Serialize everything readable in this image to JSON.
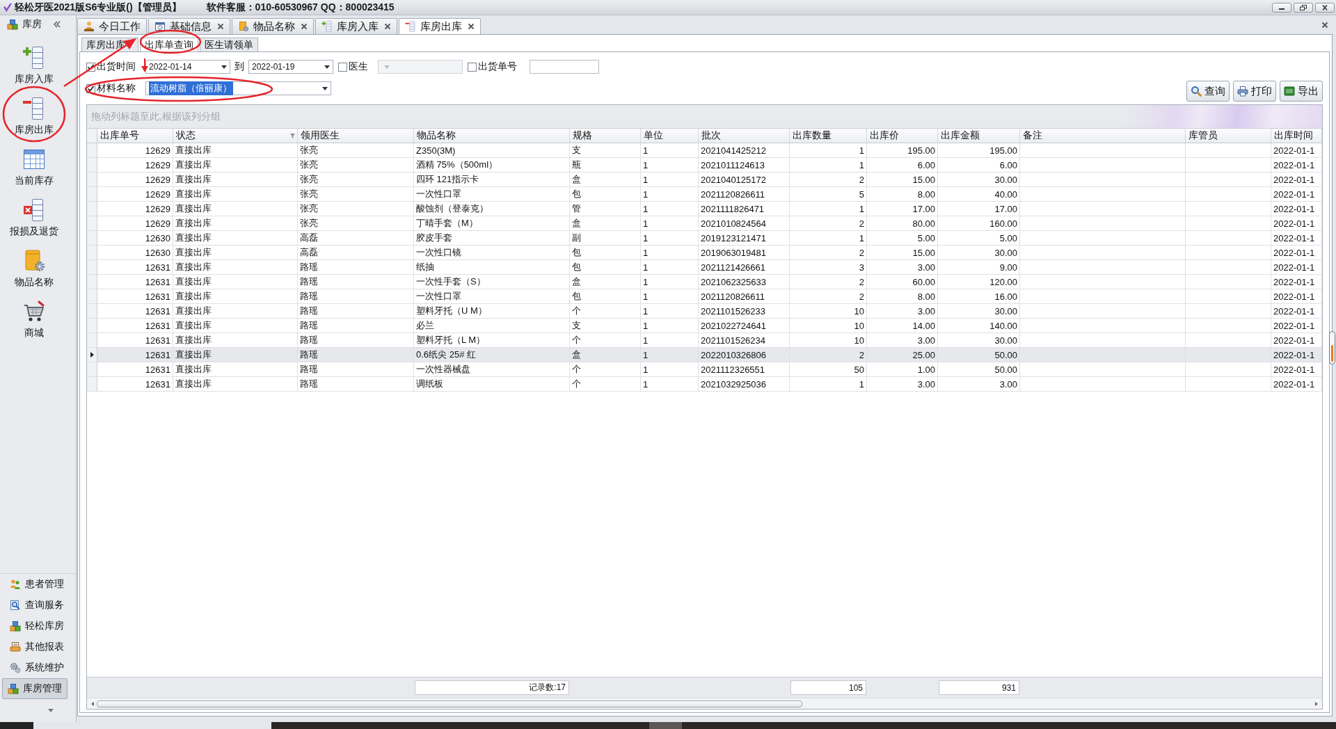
{
  "window": {
    "title": "轻松牙医2021版S6专业版()【管理员】",
    "support": "软件客服：010-60530967 QQ：800023415"
  },
  "sidebar": {
    "header": "库房",
    "items": [
      {
        "label": "库房入库",
        "kind": "stock_in"
      },
      {
        "label": "库房出库",
        "kind": "stock_out"
      },
      {
        "label": "当前库存",
        "kind": "inventory"
      },
      {
        "label": "报损及退货",
        "kind": "loss"
      },
      {
        "label": "物品名称",
        "kind": "goods"
      },
      {
        "label": "商城",
        "kind": "shop"
      }
    ],
    "nav": [
      {
        "label": "患者管理",
        "kind": "patients",
        "selected": false
      },
      {
        "label": "查询服务",
        "kind": "query",
        "selected": false
      },
      {
        "label": "轻松库房",
        "kind": "store",
        "selected": false
      },
      {
        "label": "其他报表",
        "kind": "report",
        "selected": false
      },
      {
        "label": "系统维护",
        "kind": "system",
        "selected": false
      },
      {
        "label": "库房管理",
        "kind": "store",
        "selected": true
      }
    ]
  },
  "tabs": [
    {
      "label": "今日工作",
      "kind": "today",
      "closable": false,
      "selected": false
    },
    {
      "label": "基础信息",
      "kind": "basic",
      "closable": true,
      "selected": false
    },
    {
      "label": "物品名称",
      "kind": "goods",
      "closable": true,
      "selected": false
    },
    {
      "label": "库房入库",
      "kind": "stock_in",
      "closable": true,
      "selected": false
    },
    {
      "label": "库房出库",
      "kind": "stock_out",
      "closable": true,
      "selected": true
    }
  ],
  "subtabs": [
    {
      "label": "库房出库",
      "selected": false
    },
    {
      "label": "出库单查询",
      "selected": true
    },
    {
      "label": "医生请领单",
      "selected": false
    }
  ],
  "filters": [
    [
      {
        "kind": "date_range",
        "label": "出货时间",
        "checked": true,
        "from": "2022-01-14",
        "separator": "到",
        "to": "2022-01-19"
      },
      {
        "kind": "combo",
        "label": "医生",
        "checked": false,
        "disabled": true
      },
      {
        "kind": "text",
        "label": "出货单号",
        "checked": false
      }
    ],
    [
      {
        "kind": "combo",
        "label": "材料名称",
        "checked": true,
        "disabled": false,
        "value": "流动树脂（倍丽康）",
        "text_selected": true
      }
    ]
  ],
  "buttons": [
    {
      "label": "查询",
      "kind": "search"
    },
    {
      "label": "打印",
      "kind": "print"
    },
    {
      "label": "导出",
      "kind": "export"
    }
  ],
  "grid": {
    "group_hint": "拖动列标题至此,根据该列分组",
    "columns": [
      {
        "label": "出库单号",
        "filter": false
      },
      {
        "label": "状态",
        "filter": true
      },
      {
        "label": "领用医生",
        "filter": false
      },
      {
        "label": "物品名称",
        "filter": false
      },
      {
        "label": "规格",
        "filter": false
      },
      {
        "label": "单位",
        "filter": false
      },
      {
        "label": "批次",
        "filter": false
      },
      {
        "label": "出库数量",
        "filter": false
      },
      {
        "label": "出库价",
        "filter": false
      },
      {
        "label": "出库金额",
        "filter": false
      },
      {
        "label": "备注",
        "filter": false
      },
      {
        "label": "库管员",
        "filter": false
      },
      {
        "label": "出库时间",
        "filter": false
      }
    ],
    "rows": [
      {
        "selected": false,
        "cells": [
          "12629",
          "直接出库",
          "张亮",
          "Z350(3M)",
          "支",
          "1",
          "2021041425212",
          "1",
          "195.00",
          "195.00",
          null,
          null,
          "2022-01-1"
        ]
      },
      {
        "selected": false,
        "cells": [
          "12629",
          "直接出库",
          "张亮",
          "酒精 75%（500ml）",
          "瓶",
          "1",
          "2021011124613",
          "1",
          "6.00",
          "6.00",
          null,
          null,
          "2022-01-1"
        ]
      },
      {
        "selected": false,
        "cells": [
          "12629",
          "直接出库",
          "张亮",
          "四环 121指示卡",
          "盒",
          "1",
          "2021040125172",
          "2",
          "15.00",
          "30.00",
          null,
          null,
          "2022-01-1"
        ]
      },
      {
        "selected": false,
        "cells": [
          "12629",
          "直接出库",
          "张亮",
          "一次性口罩",
          "包",
          "1",
          "2021120826611",
          "5",
          "8.00",
          "40.00",
          null,
          null,
          "2022-01-1"
        ]
      },
      {
        "selected": false,
        "cells": [
          "12629",
          "直接出库",
          "张亮",
          "酸蚀剂（登泰克）",
          "管",
          "1",
          "2021111826471",
          "1",
          "17.00",
          "17.00",
          null,
          null,
          "2022-01-1"
        ]
      },
      {
        "selected": false,
        "cells": [
          "12629",
          "直接出库",
          "张亮",
          "丁晴手套（M）",
          "盒",
          "1",
          "2021010824564",
          "2",
          "80.00",
          "160.00",
          null,
          null,
          "2022-01-1"
        ]
      },
      {
        "selected": false,
        "cells": [
          "12630",
          "直接出库",
          "高磊",
          "胶皮手套",
          "副",
          "1",
          "2019123121471",
          "1",
          "5.00",
          "5.00",
          null,
          null,
          "2022-01-1"
        ]
      },
      {
        "selected": false,
        "cells": [
          "12630",
          "直接出库",
          "高磊",
          "一次性口镜",
          "包",
          "1",
          "2019063019481",
          "2",
          "15.00",
          "30.00",
          null,
          null,
          "2022-01-1"
        ]
      },
      {
        "selected": false,
        "cells": [
          "12631",
          "直接出库",
          "路瑶",
          "纸抽",
          "包",
          "1",
          "2021121426661",
          "3",
          "3.00",
          "9.00",
          null,
          null,
          "2022-01-1"
        ]
      },
      {
        "selected": false,
        "cells": [
          "12631",
          "直接出库",
          "路瑶",
          "一次性手套（S）",
          "盒",
          "1",
          "2021062325633",
          "2",
          "60.00",
          "120.00",
          null,
          null,
          "2022-01-1"
        ]
      },
      {
        "selected": false,
        "cells": [
          "12631",
          "直接出库",
          "路瑶",
          "一次性口罩",
          "包",
          "1",
          "2021120826611",
          "2",
          "8.00",
          "16.00",
          null,
          null,
          "2022-01-1"
        ]
      },
      {
        "selected": false,
        "cells": [
          "12631",
          "直接出库",
          "路瑶",
          "塑料牙托（U M）",
          "个",
          "1",
          "2021101526233",
          "10",
          "3.00",
          "30.00",
          null,
          null,
          "2022-01-1"
        ]
      },
      {
        "selected": false,
        "cells": [
          "12631",
          "直接出库",
          "路瑶",
          "必兰",
          "支",
          "1",
          "2021022724641",
          "10",
          "14.00",
          "140.00",
          null,
          null,
          "2022-01-1"
        ]
      },
      {
        "selected": false,
        "cells": [
          "12631",
          "直接出库",
          "路瑶",
          "塑料牙托（L M）",
          "个",
          "1",
          "2021101526234",
          "10",
          "3.00",
          "30.00",
          null,
          null,
          "2022-01-1"
        ]
      },
      {
        "selected": true,
        "cells": [
          "12631",
          "直接出库",
          "路瑶",
          "0.6纸尖 25# 红",
          "盒",
          "1",
          "2022010326806",
          "2",
          "25.00",
          "50.00",
          null,
          null,
          "2022-01-1"
        ]
      },
      {
        "selected": false,
        "cells": [
          "12631",
          "直接出库",
          "路瑶",
          "一次性器械盘",
          "个",
          "1",
          "2021112326551",
          "50",
          "1.00",
          "50.00",
          null,
          null,
          "2022-01-1"
        ]
      },
      {
        "selected": false,
        "cells": [
          "12631",
          "直接出库",
          "路瑶",
          "调纸板",
          "个",
          "1",
          "2021032925036",
          "1",
          "3.00",
          "3.00",
          null,
          null,
          "2022-01-1"
        ]
      }
    ],
    "footer": {
      "count": "记录数:17",
      "quantity": "105",
      "amount": "931"
    }
  }
}
